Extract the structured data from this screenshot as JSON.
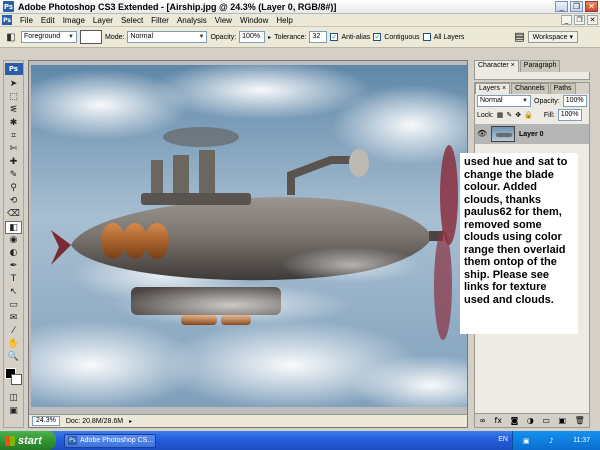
{
  "window": {
    "title": "Adobe Photoshop CS3 Extended - [Airship.jpg @ 24.3% (Layer 0, RGB/8#)]",
    "app_icon": "Ps"
  },
  "menu": {
    "items": [
      "File",
      "Edit",
      "Image",
      "Layer",
      "Select",
      "Filter",
      "Analysis",
      "View",
      "Window",
      "Help"
    ]
  },
  "options": {
    "fill_source": "Foreground",
    "mode_label": "Mode:",
    "mode_value": "Normal",
    "opacity_label": "Opacity:",
    "opacity_value": "100%",
    "tolerance_label": "Tolerance:",
    "tolerance_value": "32",
    "antialias_label": "Anti-alias",
    "contiguous_label": "Contiguous",
    "all_layers_label": "All Layers",
    "workspace_label": "Workspace"
  },
  "toolbox": {
    "badge": "Ps",
    "tools": [
      "move-tool",
      "marquee-tool",
      "lasso-tool",
      "magic-wand-tool",
      "crop-tool",
      "slice-tool",
      "healing-tool",
      "brush-tool",
      "clone-stamp-tool",
      "history-brush-tool",
      "eraser-tool",
      "paint-bucket-tool",
      "blur-tool",
      "dodge-tool",
      "pen-tool",
      "type-tool",
      "path-selection-tool",
      "shape-tool",
      "notes-tool",
      "eyedropper-tool",
      "hand-tool",
      "zoom-tool"
    ],
    "glyphs": [
      "➤",
      "⬚",
      "ᓬ",
      "✱",
      "⌗",
      "✄",
      "✚",
      "✎",
      "⚲",
      "⟲",
      "⌫",
      "◧",
      "◉",
      "◐",
      "✒",
      "T",
      "↖",
      "▭",
      "✉",
      "⁄",
      "✋",
      "🔍"
    ],
    "active_index": 11
  },
  "document": {
    "zoom": "24.3%",
    "doc_info": "Doc: 20.8M/28.6M"
  },
  "annotation": {
    "text": "used hue and sat to change the blade colour. Added clouds, thanks paulus62 for them, removed some clouds using color range then overlaid them ontop of the ship. Please see links for texture used and clouds."
  },
  "panels": {
    "top_tabs": [
      "Character",
      "Paragraph"
    ],
    "layer_tabs": [
      "Layers",
      "Channels",
      "Paths"
    ],
    "blend_mode": "Normal",
    "opacity_label": "Opacity:",
    "opacity_value": "100%",
    "lock_label": "Lock:",
    "fill_label": "Fill:",
    "fill_value": "100%",
    "layer_name": "Layer 0",
    "footer_icons": [
      "link-icon",
      "fx-icon",
      "mask-icon",
      "adjustment-icon",
      "group-icon",
      "new-layer-icon",
      "trash-icon"
    ],
    "footer_glyphs": [
      "∞",
      "fx",
      "◙",
      "◑",
      "▭",
      "▣",
      "🗑"
    ]
  },
  "taskbar": {
    "start_label": "start",
    "task_label": "Adobe Photoshop CS...",
    "lang": "EN",
    "time": "11:37"
  }
}
